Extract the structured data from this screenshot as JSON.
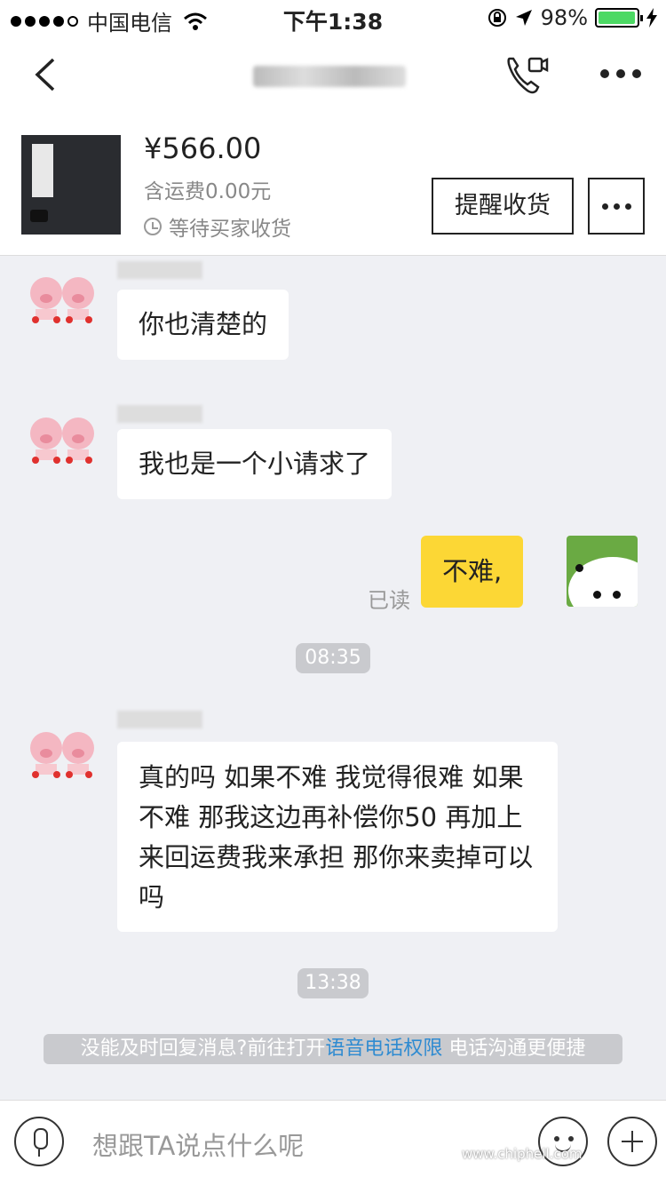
{
  "status_bar": {
    "carrier": "中国电信",
    "time": "下午1:38",
    "battery": "98%",
    "battery_level": 0.98
  },
  "order": {
    "price": "¥566.00",
    "shipping": "含运费0.00元",
    "status": "等待买家收货",
    "remind_button": "提醒收货"
  },
  "messages": [
    {
      "side": "them",
      "text": "你也清楚的"
    },
    {
      "side": "them",
      "text": "我也是一个小请求了"
    },
    {
      "side": "me",
      "text": "不难,",
      "read_label": "已读"
    },
    {
      "time": "08:35"
    },
    {
      "side": "them",
      "text": "真的吗 如果不难 我觉得很难 如果不难 那我这边再补偿你50 再加上来回运费我来承担 那你来卖掉可以吗"
    },
    {
      "time": "13:38"
    }
  ],
  "notice": {
    "prefix": "没能及时回复消息?前往打开",
    "link": "语音电话权限",
    "suffix": " 电话沟通更便捷"
  },
  "input": {
    "placeholder": "想跟TA说点什么呢"
  },
  "watermark": "www.chiphell.com"
}
